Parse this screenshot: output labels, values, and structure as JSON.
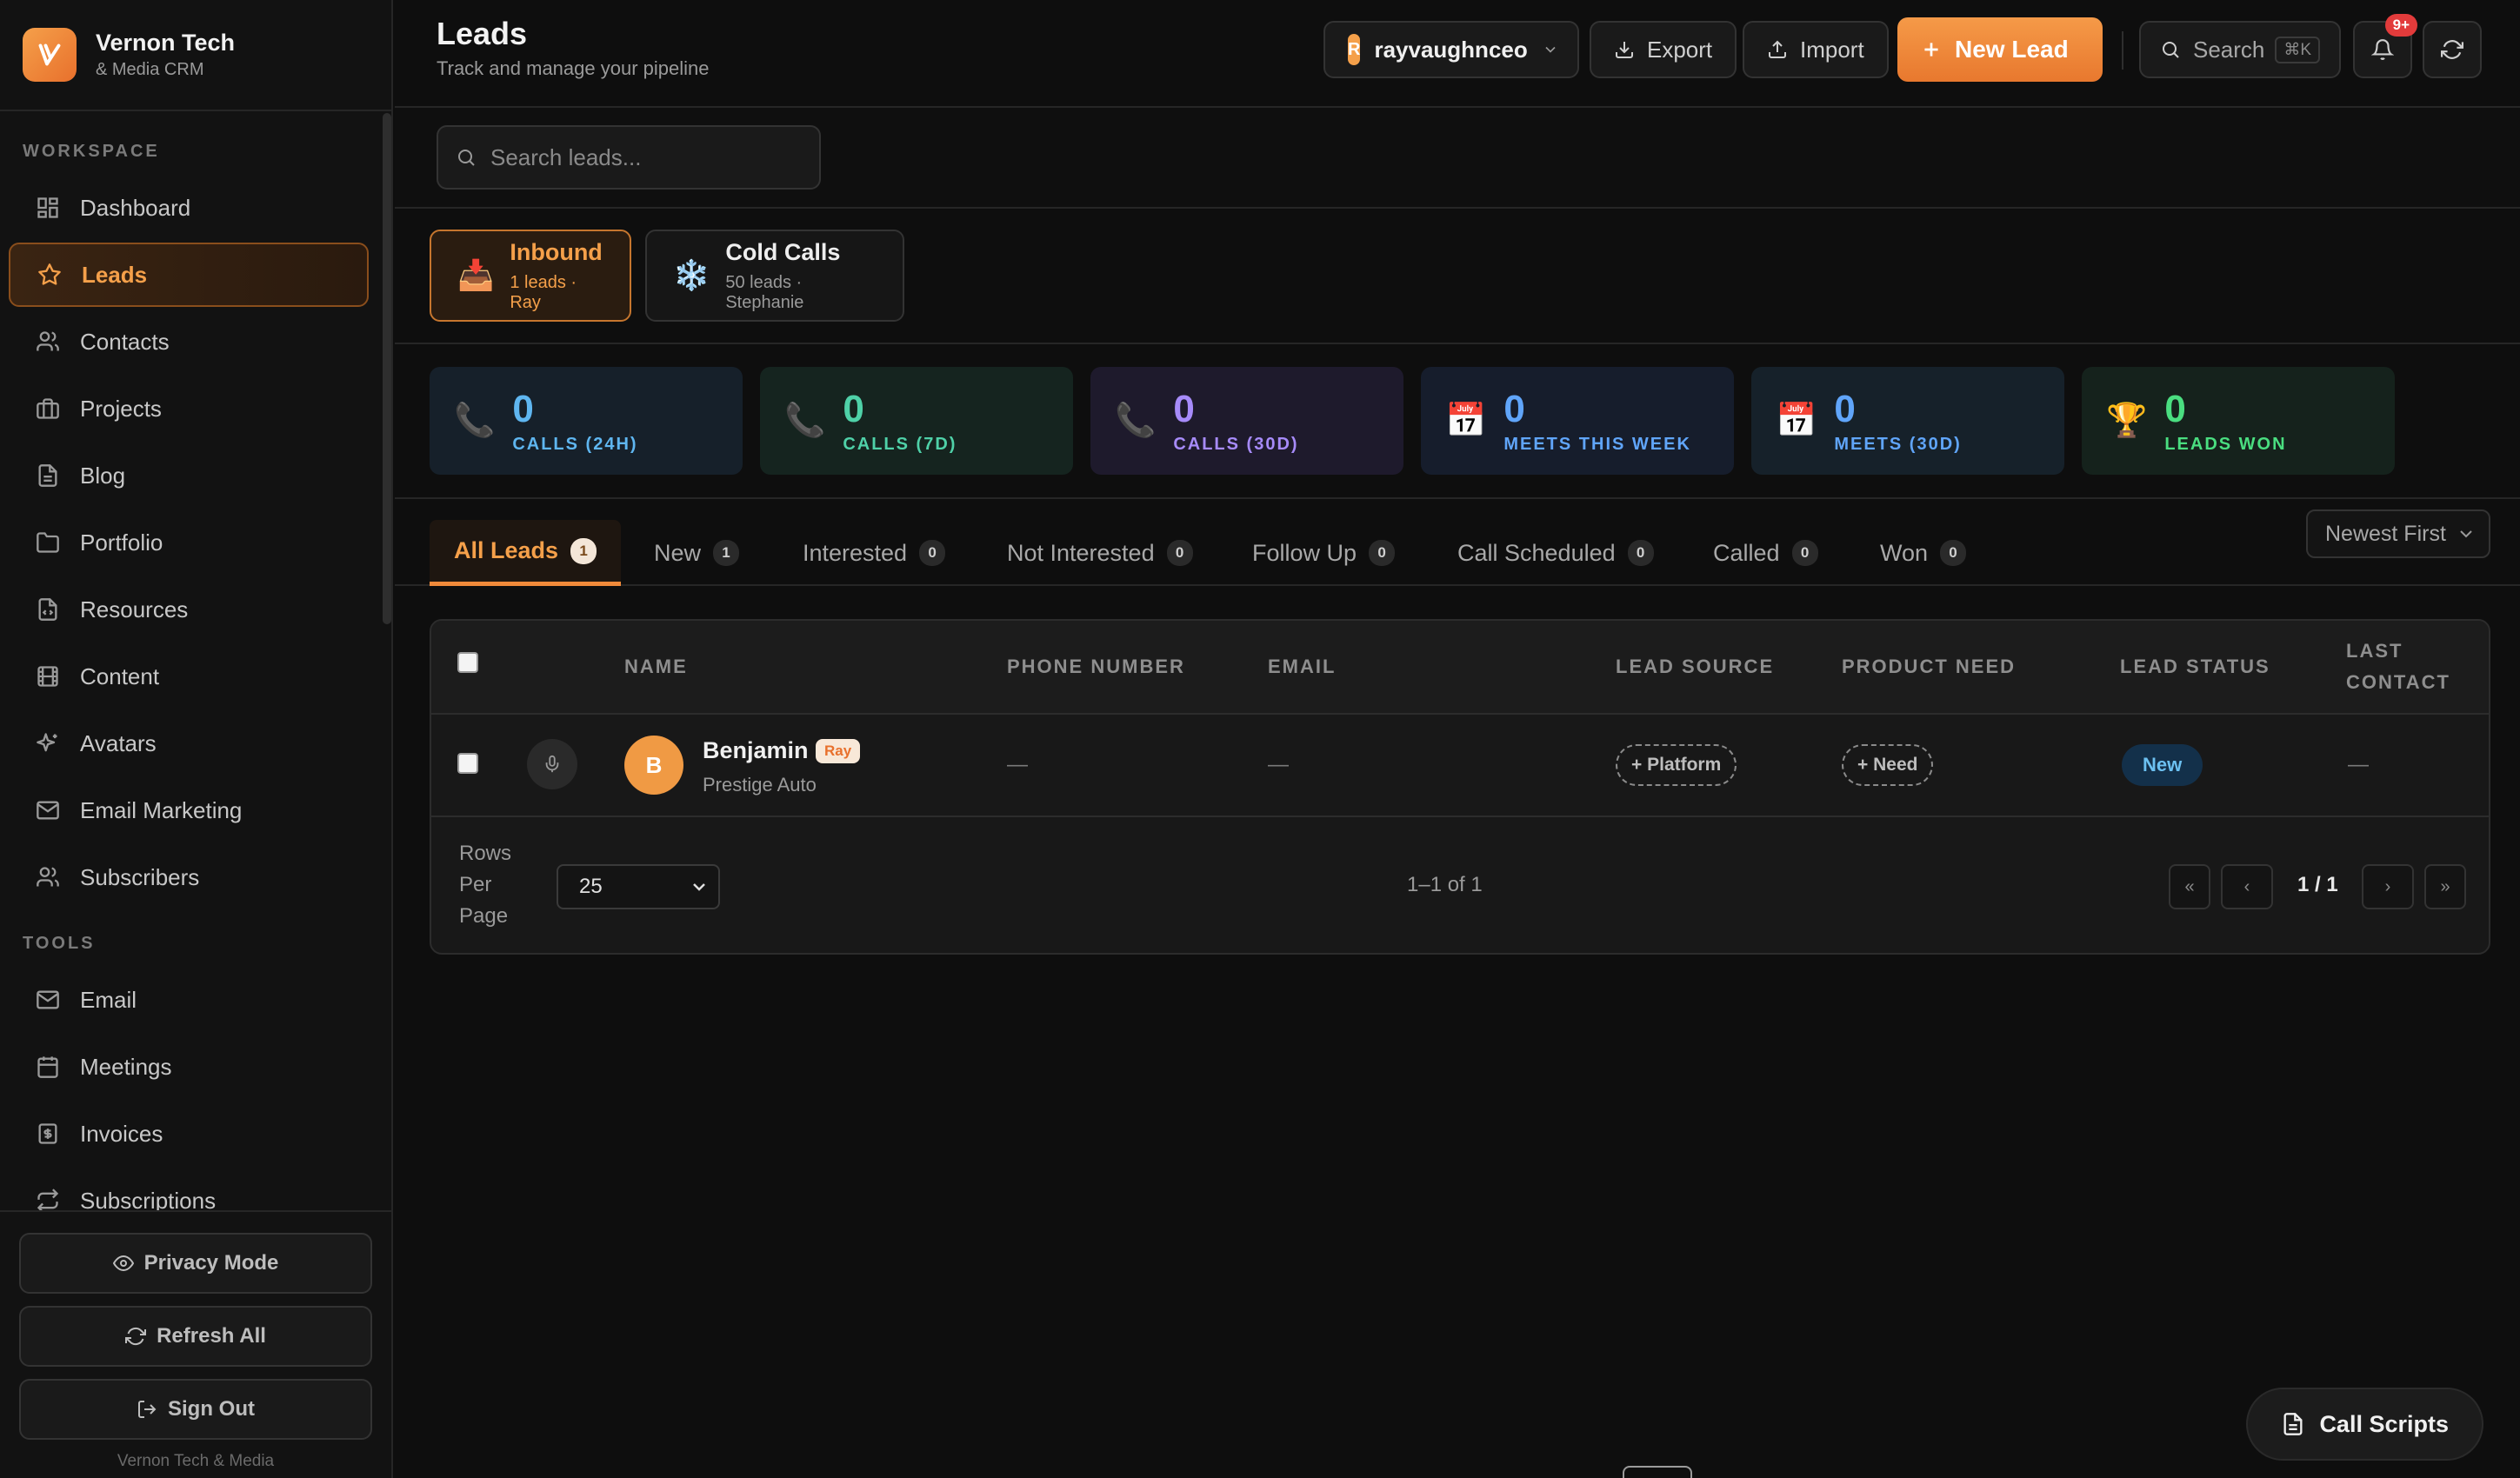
{
  "brand": {
    "name": "Vernon Tech",
    "subtitle": "& Media CRM"
  },
  "sidebar": {
    "workspace_label": "WORKSPACE",
    "workspace_items": [
      {
        "label": "Dashboard",
        "icon": "grid-icon"
      },
      {
        "label": "Leads",
        "icon": "star-icon",
        "active": true
      },
      {
        "label": "Contacts",
        "icon": "users-icon"
      },
      {
        "label": "Projects",
        "icon": "briefcase-icon"
      },
      {
        "label": "Blog",
        "icon": "document-icon"
      },
      {
        "label": "Portfolio",
        "icon": "folder-icon"
      },
      {
        "label": "Resources",
        "icon": "file-code-icon"
      },
      {
        "label": "Content",
        "icon": "film-icon"
      },
      {
        "label": "Avatars",
        "icon": "sparkles-icon"
      },
      {
        "label": "Email Marketing",
        "icon": "mail-icon"
      },
      {
        "label": "Subscribers",
        "icon": "users-icon"
      }
    ],
    "tools_label": "TOOLS",
    "tools_items": [
      {
        "label": "Email",
        "icon": "mail-icon"
      },
      {
        "label": "Meetings",
        "icon": "calendar-icon"
      },
      {
        "label": "Invoices",
        "icon": "receipt-icon"
      },
      {
        "label": "Subscriptions",
        "icon": "repeat-icon"
      }
    ],
    "privacy_label": "Privacy Mode",
    "refresh_label": "Refresh All",
    "signout_label": "Sign Out",
    "footer": "Vernon Tech & Media"
  },
  "header": {
    "title": "Leads",
    "subtitle": "Track and manage your pipeline",
    "account": {
      "initial": "R",
      "name": "rayvaughnceo"
    },
    "export_label": "Export",
    "import_label": "Import",
    "new_lead_label": "New Lead",
    "search_label": "Search",
    "search_shortcut": "⌘K",
    "notifications_badge": "9+"
  },
  "search": {
    "placeholder": "Search leads..."
  },
  "campaigns": [
    {
      "emoji": "📥",
      "name": "Inbound",
      "sub": "1 leads · Ray",
      "active": true
    },
    {
      "emoji": "❄️",
      "name": "Cold Calls",
      "sub": "50 leads · Stephanie",
      "active": false
    }
  ],
  "stats": [
    {
      "emoji": "📞",
      "value": "0",
      "label": "CALLS (24H)",
      "color": "#5fb6f0",
      "bg": "#16202a"
    },
    {
      "emoji": "📞",
      "value": "0",
      "label": "CALLS (7D)",
      "color": "#4fd1a8",
      "bg": "#15241f"
    },
    {
      "emoji": "📞",
      "value": "0",
      "label": "CALLS (30D)",
      "color": "#a78bfa",
      "bg": "#1e1a2c"
    },
    {
      "emoji": "📅",
      "value": "0",
      "label": "MEETS THIS WEEK",
      "color": "#60a5fa",
      "bg": "#161d2c"
    },
    {
      "emoji": "📅",
      "value": "0",
      "label": "MEETS (30D)",
      "color": "#60a5fa",
      "bg": "#16212a"
    },
    {
      "emoji": "🏆",
      "value": "0",
      "label": "LEADS WON",
      "color": "#4ade80",
      "bg": "#15221c"
    }
  ],
  "tabs": [
    {
      "label": "All Leads",
      "count": "1",
      "active": true
    },
    {
      "label": "New",
      "count": "1"
    },
    {
      "label": "Interested",
      "count": "0"
    },
    {
      "label": "Not Interested",
      "count": "0"
    },
    {
      "label": "Follow Up",
      "count": "0"
    },
    {
      "label": "Call Scheduled",
      "count": "0"
    },
    {
      "label": "Called",
      "count": "0"
    },
    {
      "label": "Won",
      "count": "0"
    }
  ],
  "sort": {
    "value": "Newest First"
  },
  "table": {
    "columns": [
      "NAME",
      "PHONE NUMBER",
      "EMAIL",
      "LEAD SOURCE",
      "PRODUCT NEED",
      "LEAD STATUS",
      "LAST",
      "CONTACT"
    ],
    "rows": [
      {
        "initial": "B",
        "name": "Benjamin",
        "owner": "Ray",
        "company": "Prestige Auto",
        "phone": "—",
        "email": "—",
        "source": "+ Platform",
        "need": "+ Need",
        "status": "New",
        "last_contact": "—"
      }
    ]
  },
  "pager": {
    "rows_label_1": "Rows",
    "rows_label_2": "Per",
    "rows_label_3": "Page",
    "rows_value": "25",
    "count": "1–1 of 1",
    "first": "«",
    "prev": "‹",
    "page": "1 / 1",
    "next": "›",
    "last": "»"
  },
  "call_scripts_label": "Call Scripts",
  "colors": {
    "accent": "#f08a3a",
    "background": "#0e0e0e"
  }
}
